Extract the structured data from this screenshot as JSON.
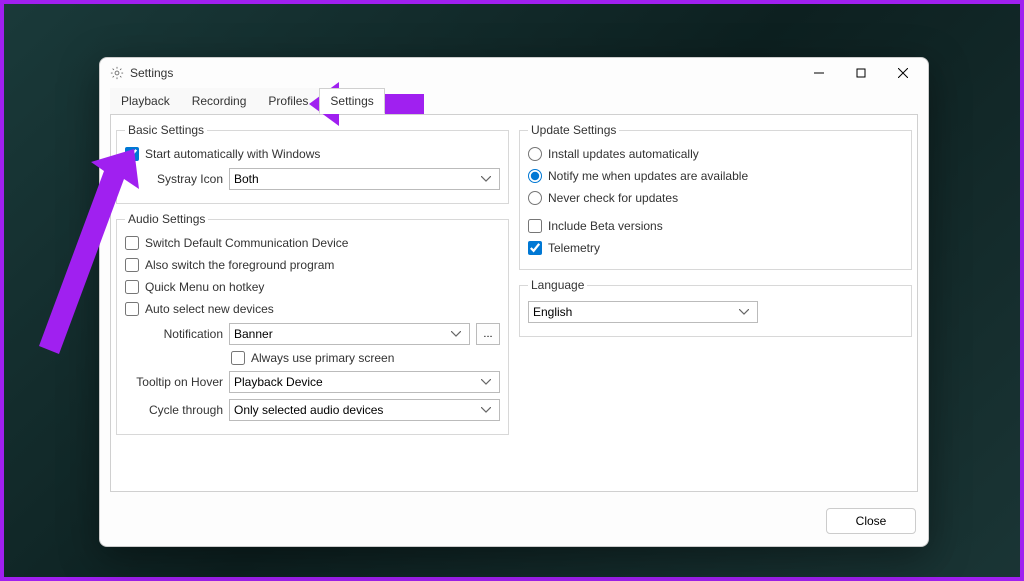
{
  "window": {
    "title": "Settings"
  },
  "tabs": [
    "Playback",
    "Recording",
    "Profiles",
    "Settings"
  ],
  "activeTab": 3,
  "basic": {
    "legend": "Basic Settings",
    "startAuto": {
      "label": "Start automatically with Windows",
      "checked": true
    },
    "systrayLabel": "Systray Icon",
    "systrayValue": "Both"
  },
  "audio": {
    "legend": "Audio Settings",
    "switchComm": {
      "label": "Switch Default Communication Device",
      "checked": false
    },
    "switchForeground": {
      "label": "Also switch the foreground program",
      "checked": false
    },
    "quickMenu": {
      "label": "Quick Menu on hotkey",
      "checked": false
    },
    "autoSelect": {
      "label": "Auto select new devices",
      "checked": false
    },
    "notificationLabel": "Notification",
    "notificationValue": "Banner",
    "notificationMoreBtn": "...",
    "alwaysPrimary": {
      "label": "Always use primary screen",
      "checked": false
    },
    "tooltipLabel": "Tooltip on Hover",
    "tooltipValue": "Playback Device",
    "cycleLabel": "Cycle through",
    "cycleValue": "Only selected audio devices"
  },
  "update": {
    "legend": "Update Settings",
    "opt1": "Install updates automatically",
    "opt2": "Notify me when updates are available",
    "opt3": "Never check for updates",
    "selected": 1,
    "beta": {
      "label": "Include Beta versions",
      "checked": false
    },
    "telemetry": {
      "label": "Telemetry",
      "checked": true
    }
  },
  "language": {
    "legend": "Language",
    "value": "English"
  },
  "footer": {
    "close": "Close"
  },
  "annotations": {
    "color": "#a020f0"
  }
}
